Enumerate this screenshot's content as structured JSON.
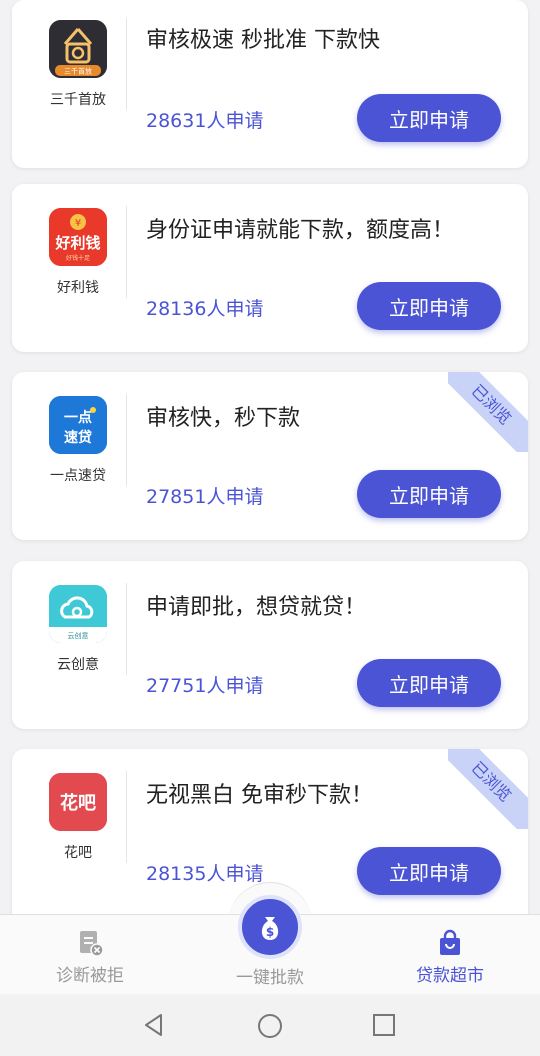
{
  "apply_label": "立即申请",
  "viewed_label": "已浏览",
  "cards": [
    {
      "name": "三千首放",
      "slogan": "审核极速 秒批准 下款快",
      "count": "28631人申请",
      "viewed": false
    },
    {
      "name": "好利钱",
      "slogan": "身份证申请就能下款，额度高！",
      "count": "28136人申请",
      "viewed": false
    },
    {
      "name": "一点速贷",
      "slogan": "审核快，秒下款",
      "count": "27851人申请",
      "viewed": true
    },
    {
      "name": "云创意",
      "slogan": "申请即批，想贷就贷！",
      "count": "27751人申请",
      "viewed": false
    },
    {
      "name": "花吧",
      "slogan": "无视黑白 免审秒下款！",
      "count": "28135人申请",
      "viewed": true
    }
  ],
  "logo_text": {
    "sanqian_badge": "三千首放",
    "haoliqian": "好利钱",
    "haoliqian_small": "好钱十足",
    "yidian_top": "一点",
    "yidian_bottom": "速贷",
    "yunchuangyi": "云创意",
    "huaba": "花吧"
  },
  "tabbar": {
    "left": "诊断被拒",
    "center": "一键批款",
    "right": "贷款超市"
  },
  "colors": {
    "accent": "#4a54d4",
    "ribbon_bg": "#c9d3f7",
    "inactive_tab": "#9a9a9a"
  }
}
